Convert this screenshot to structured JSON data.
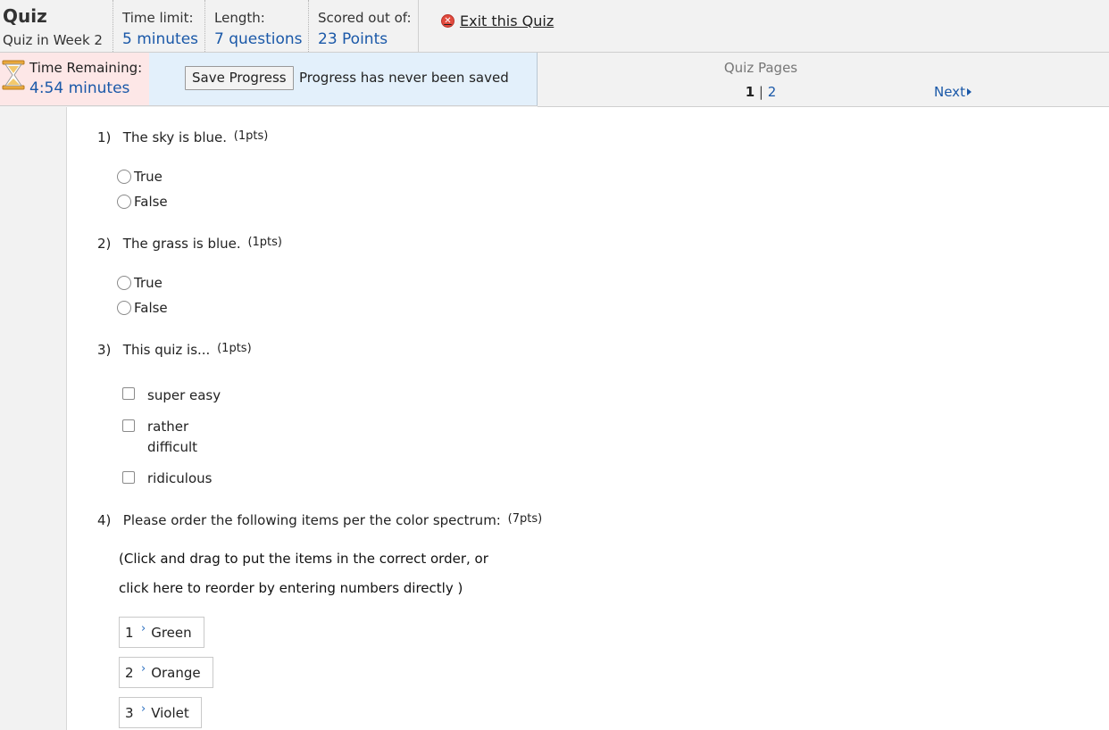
{
  "header": {
    "title": "Quiz",
    "subtitle": "Quiz in Week 2",
    "time_limit_label": "Time limit:",
    "time_limit_value": "5 minutes",
    "length_label": "Length:",
    "length_value": "7 questions",
    "score_label": "Scored out of:",
    "score_value": "23 Points",
    "exit_label": "Exit this Quiz",
    "exit_icon": "close-circle-icon"
  },
  "timer": {
    "label": "Time Remaining:",
    "value": "4:54 minutes",
    "icon": "hourglass-icon"
  },
  "save": {
    "button_label": "Save Progress",
    "status": "Progress has never been saved"
  },
  "pages": {
    "label": "Quiz Pages",
    "current": "1",
    "separator": "|",
    "other": "2",
    "next_label": "Next"
  },
  "questions": [
    {
      "number": "1)",
      "text": "The sky is blue.",
      "points": "(1pts)",
      "options": [
        "True",
        "False"
      ]
    },
    {
      "number": "2)",
      "text": "The grass is blue.",
      "points": "(1pts)",
      "options": [
        "True",
        "False"
      ]
    },
    {
      "number": "3)",
      "text": "This quiz is...",
      "points": "(1pts)",
      "options": [
        "super easy",
        "rather difficult",
        "ridiculous"
      ]
    },
    {
      "number": "4)",
      "text": "Please order the following items per the color spectrum:",
      "points": "(7pts)",
      "instruction_line1": "(Click and drag to put the items in the correct order, or",
      "instruction_line2": "click here to reorder by entering numbers directly )",
      "items": [
        {
          "index": "1",
          "label": "Green"
        },
        {
          "index": "2",
          "label": "Orange"
        },
        {
          "index": "3",
          "label": "Violet"
        }
      ]
    }
  ],
  "colors": {
    "link": "#1a58a8",
    "timer_bg": "#fde7e7",
    "save_bg": "#e3f0fb",
    "exit_icon": "#e24a3d"
  }
}
